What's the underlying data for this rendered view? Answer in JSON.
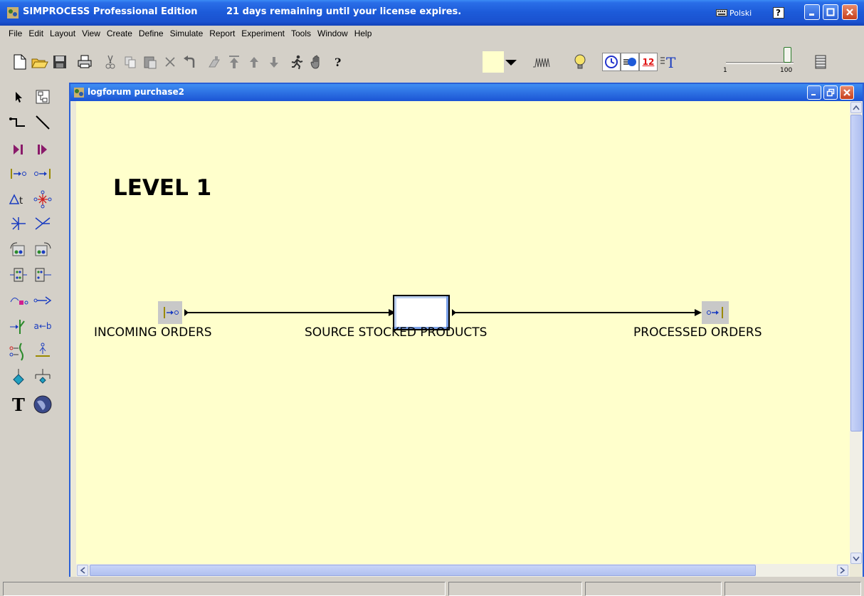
{
  "app": {
    "title": "SIMPROCESS Professional Edition",
    "license_notice": "21 days remaining until your license expires.",
    "language": "Polski"
  },
  "menu": [
    "File",
    "Edit",
    "Layout",
    "View",
    "Create",
    "Define",
    "Simulate",
    "Report",
    "Experiment",
    "Tools",
    "Window",
    "Help"
  ],
  "toolbar": {
    "slider_min": "1",
    "slider_max": "100",
    "font_size": "12"
  },
  "document": {
    "title": "logforum purchase2",
    "heading": "LEVEL 1",
    "nodes": {
      "incoming": "INCOMING ORDERS",
      "source": "SOURCE STOCKED PRODUCTS",
      "processed": "PROCESSED ORDERS"
    }
  },
  "colors": {
    "canvas": "#ffffcc",
    "titlebar": "#1c5ad8"
  }
}
